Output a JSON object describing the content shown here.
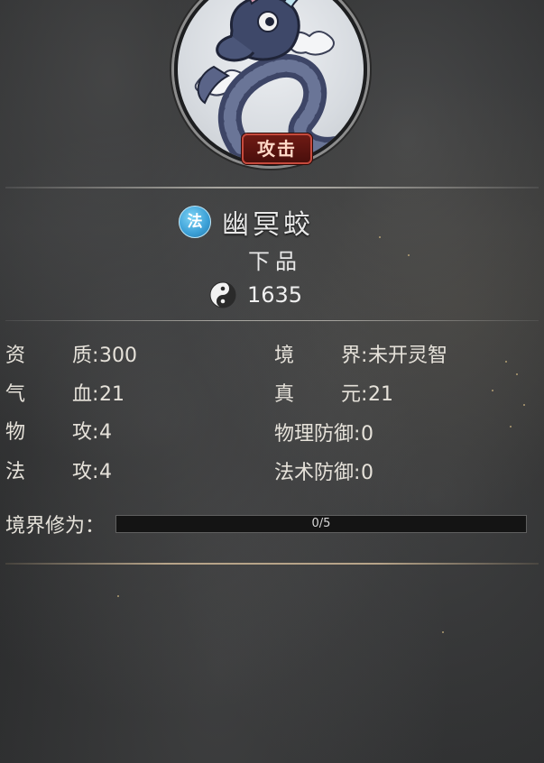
{
  "pet": {
    "skill_tag": "攻击",
    "type_badge": "法",
    "name": "幽冥蛟",
    "grade": "下品",
    "power": "1635",
    "portrait_icon": "serpent-dragon-portrait",
    "power_icon": "yin-yang-icon"
  },
  "stats": {
    "aptitude": {
      "label_a": "资",
      "label_b": "质",
      "colon": ":",
      "value": "300"
    },
    "realm": {
      "label_a": "境",
      "label_b": "界",
      "colon": ":",
      "value": "未开灵智"
    },
    "hp": {
      "label_a": "气",
      "label_b": "血",
      "colon": ":",
      "value": "21"
    },
    "qi": {
      "label_a": "真",
      "label_b": "元",
      "colon": ":",
      "value": "21"
    },
    "phys_atk": {
      "label_a": "物",
      "label_b": "攻",
      "colon": ":",
      "value": "4"
    },
    "phys_def": {
      "label": "物理防御",
      "colon": ":",
      "value": "0"
    },
    "mag_atk": {
      "label_a": "法",
      "label_b": "攻",
      "colon": ":",
      "value": "4"
    },
    "mag_def": {
      "label": "法术防御",
      "colon": ":",
      "value": "0"
    }
  },
  "cultivation": {
    "label": "境界修为：",
    "progress_text": "0/5",
    "progress_fraction": 0
  },
  "colors": {
    "badge_blue": "#3b9fd6",
    "tag_red": "#6e1a14",
    "divider": "#a7a59f"
  }
}
